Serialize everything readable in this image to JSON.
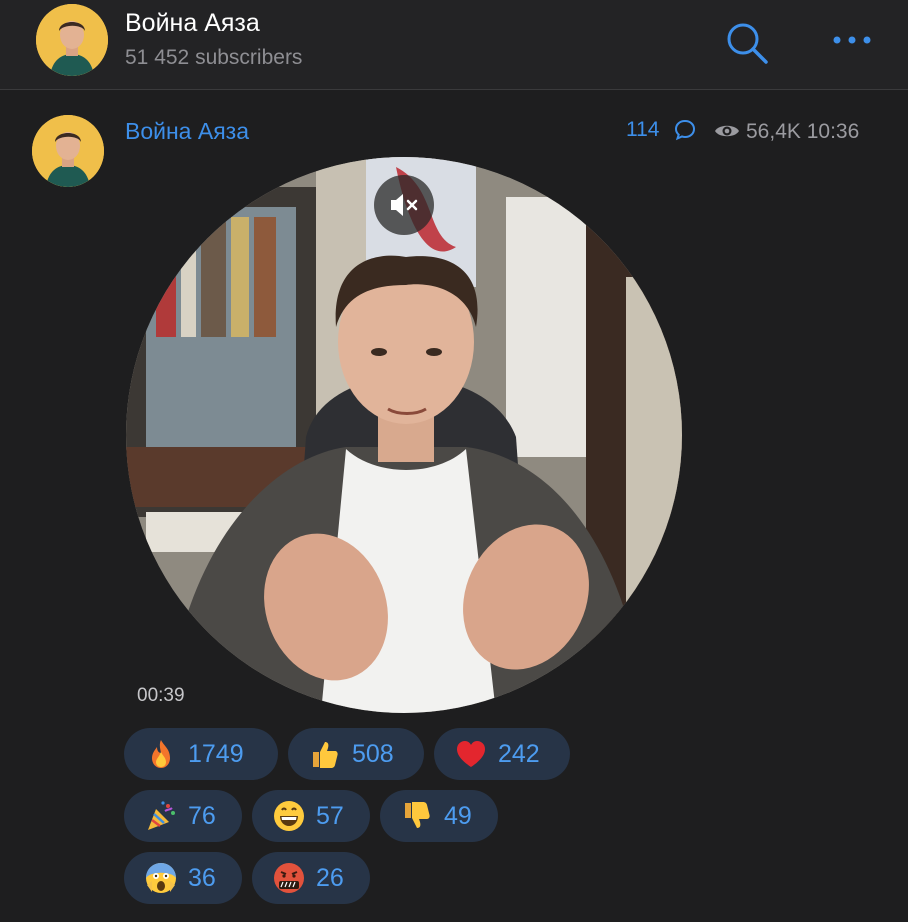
{
  "header": {
    "title": "Война Аяза",
    "subtitle": "51 452 subscribers"
  },
  "post": {
    "author": "Война Аяза",
    "comments": "114",
    "views_time": "56,4K 10:36",
    "duration": "00:39"
  },
  "reactions": [
    {
      "icon": "fire-icon",
      "count": "1749"
    },
    {
      "icon": "thumbs-up-icon",
      "count": "508"
    },
    {
      "icon": "heart-icon",
      "count": "242"
    },
    {
      "icon": "party-popper-icon",
      "count": "76"
    },
    {
      "icon": "grinning-face-icon",
      "count": "57"
    },
    {
      "icon": "thumbs-down-icon",
      "count": "49"
    },
    {
      "icon": "screaming-face-icon",
      "count": "36"
    },
    {
      "icon": "cursing-face-icon",
      "count": "26"
    }
  ],
  "colors": {
    "accent": "#3d8fea",
    "background": "#1e1e1f",
    "reaction_bg": "#273447"
  }
}
